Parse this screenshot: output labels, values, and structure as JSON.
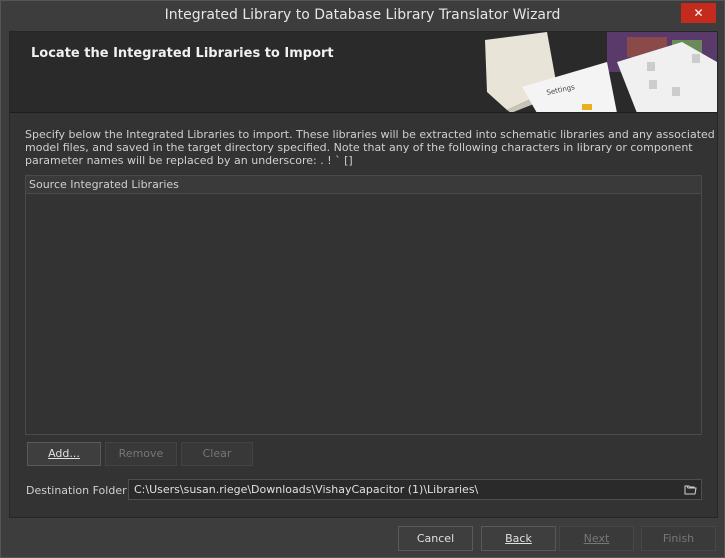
{
  "window": {
    "title": "Integrated Library to Database Library Translator Wizard",
    "close_label": "✕"
  },
  "header": {
    "title": "Locate the Integrated Libraries to Import",
    "art_text": "Settings"
  },
  "description": "Specify below the Integrated Libraries to import. These libraries will be extracted into schematic libraries and any associated model files, and saved in the target directory specified. Note that any of the following characters in library or component parameter names will be replaced by an underscore: . ! ` []",
  "list": {
    "column_header": "Source Integrated Libraries",
    "items": []
  },
  "list_buttons": {
    "add": "Add...",
    "remove": "Remove",
    "clear": "Clear"
  },
  "destination": {
    "label": "Destination Folder",
    "value": "C:\\Users\\susan.riege\\Downloads\\VishayCapacitor (1)\\Libraries\\"
  },
  "footer": {
    "cancel": "Cancel",
    "back": "Back",
    "next": "Next",
    "finish": "Finish"
  },
  "colors": {
    "close_button": "#c42b1c",
    "background": "#3d3d3d",
    "panel": "#333333"
  }
}
